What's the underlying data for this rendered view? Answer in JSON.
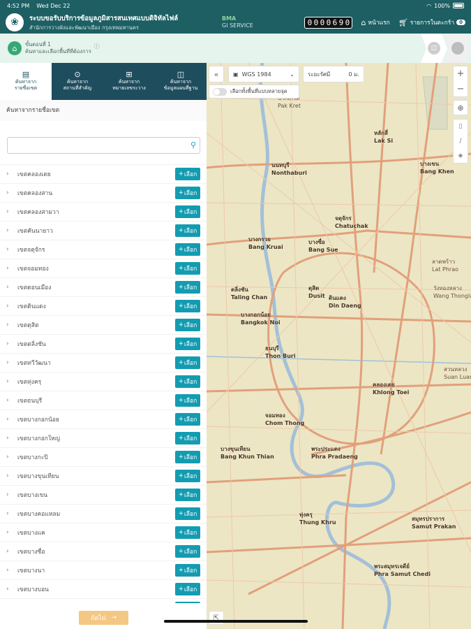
{
  "status": {
    "time": "4:52 PM",
    "date": "Wed Dec 22",
    "battery": "100%"
  },
  "header": {
    "title": "ระบบขอรับบริการข้อมูลภูมิสารสนเทศแบบดิจิทัลไฟล์",
    "subtitle": "สำนักการวางผังและพัฒนาเมือง กรุงเทพมหานคร",
    "gis_label": "BMA",
    "gis_sub": "GI SERVICE",
    "counter": [
      "0",
      "0",
      "0",
      "0",
      "6",
      "9",
      "0"
    ],
    "home_label": "หน้าแรก",
    "cart_label": "รายการในตะกร้า",
    "cart_count": "0"
  },
  "step": {
    "line1": "ขั้นตอนที่ 1",
    "line2": "ค้นหาและเลือกพื้นที่ที่ต้องการ"
  },
  "tabs": [
    {
      "line1": "ค้นหาจาก",
      "line2": "รายชื่อเขต",
      "icon": "document-icon"
    },
    {
      "line1": "ค้นหาจาก",
      "line2": "สถานที่สำคัญ",
      "icon": "location-pin-icon"
    },
    {
      "line1": "ค้นหาจาก",
      "line2": "หมายเลขระวาง",
      "icon": "grid-icon"
    },
    {
      "line1": "ค้นหาจาก",
      "line2": "ข้อมูลแผนที่ฐาน",
      "icon": "map-icon"
    }
  ],
  "section_title": "ค้นหาจากรายชื่อเขต",
  "search": {
    "placeholder": ""
  },
  "add_label": "เลือก",
  "districts": [
    "เขตคลองเตย",
    "เขตคลองสาน",
    "เขตคลองสามวา",
    "เขตคันนายาว",
    "เขตจตุจักร",
    "เขตจอมทอง",
    "เขตดอนเมือง",
    "เขตดินแดง",
    "เขตดุสิต",
    "เขตตลิ่งชัน",
    "เขตทวีวัฒนา",
    "เขตทุ่งครุ",
    "เขตธนบุรี",
    "เขตบางกอกน้อย",
    "เขตบางกอกใหญ่",
    "เขตบางกะปิ",
    "เขตบางขุนเทียน",
    "เขตบางเขน",
    "เขตบางคอแหลม",
    "เขตบางแค",
    "เขตบางซื่อ",
    "เขตบางนา",
    "เขตบางบอน",
    "เขตบางพลัด"
  ],
  "next_label": "ถัดไป",
  "map": {
    "crs": "WGS 1984",
    "distance_label": "ระยะรัศมี",
    "distance_value": "0 ม.",
    "toggle_label": "เลือกทั้งพื้นที่แบบหลายจุด",
    "labels": [
      {
        "th": "ปากเกร็ด",
        "en": "Pak Kret"
      },
      {
        "th": "หลักสี่",
        "en": "Lak Si"
      },
      {
        "th": "บางเขน",
        "en": "Bang Khen"
      },
      {
        "th": "นนทบุรี",
        "en": "Nonthaburi"
      },
      {
        "th": "จตุจักร",
        "en": "Chatuchak"
      },
      {
        "th": "บางกรวย",
        "en": "Bang Kruai"
      },
      {
        "th": "บางซื่อ",
        "en": "Bang Sue"
      },
      {
        "th": "ลาดพร้าว",
        "en": "Lat Phrao"
      },
      {
        "th": "วังทองหลาง",
        "en": "Wang Thonglang"
      },
      {
        "th": "ดุสิต",
        "en": "Dusit"
      },
      {
        "th": "ดินแดง",
        "en": "Din Daeng"
      },
      {
        "th": "ตลิ่งชัน",
        "en": "Taling Chan"
      },
      {
        "th": "บางกอกน้อย",
        "en": "Bangkok Noi"
      },
      {
        "th": "ธนบุรี",
        "en": "Thon Buri"
      },
      {
        "th": "สวนหลวง",
        "en": "Suan Luang"
      },
      {
        "th": "คลองเตย",
        "en": "Khlong Toei"
      },
      {
        "th": "จอมทอง",
        "en": "Chom Thong"
      },
      {
        "th": "บางขุนเทียน",
        "en": "Bang Khun Thian"
      },
      {
        "th": "พระประแดง",
        "en": "Phra Pradaeng"
      },
      {
        "th": "ทุ่งครุ",
        "en": "Thung Khru"
      },
      {
        "th": "สมุทรปราการ",
        "en": "Samut Prakan"
      },
      {
        "th": "พระสมุทรเจดีย์",
        "en": "Phra Samut Chedi"
      }
    ]
  }
}
